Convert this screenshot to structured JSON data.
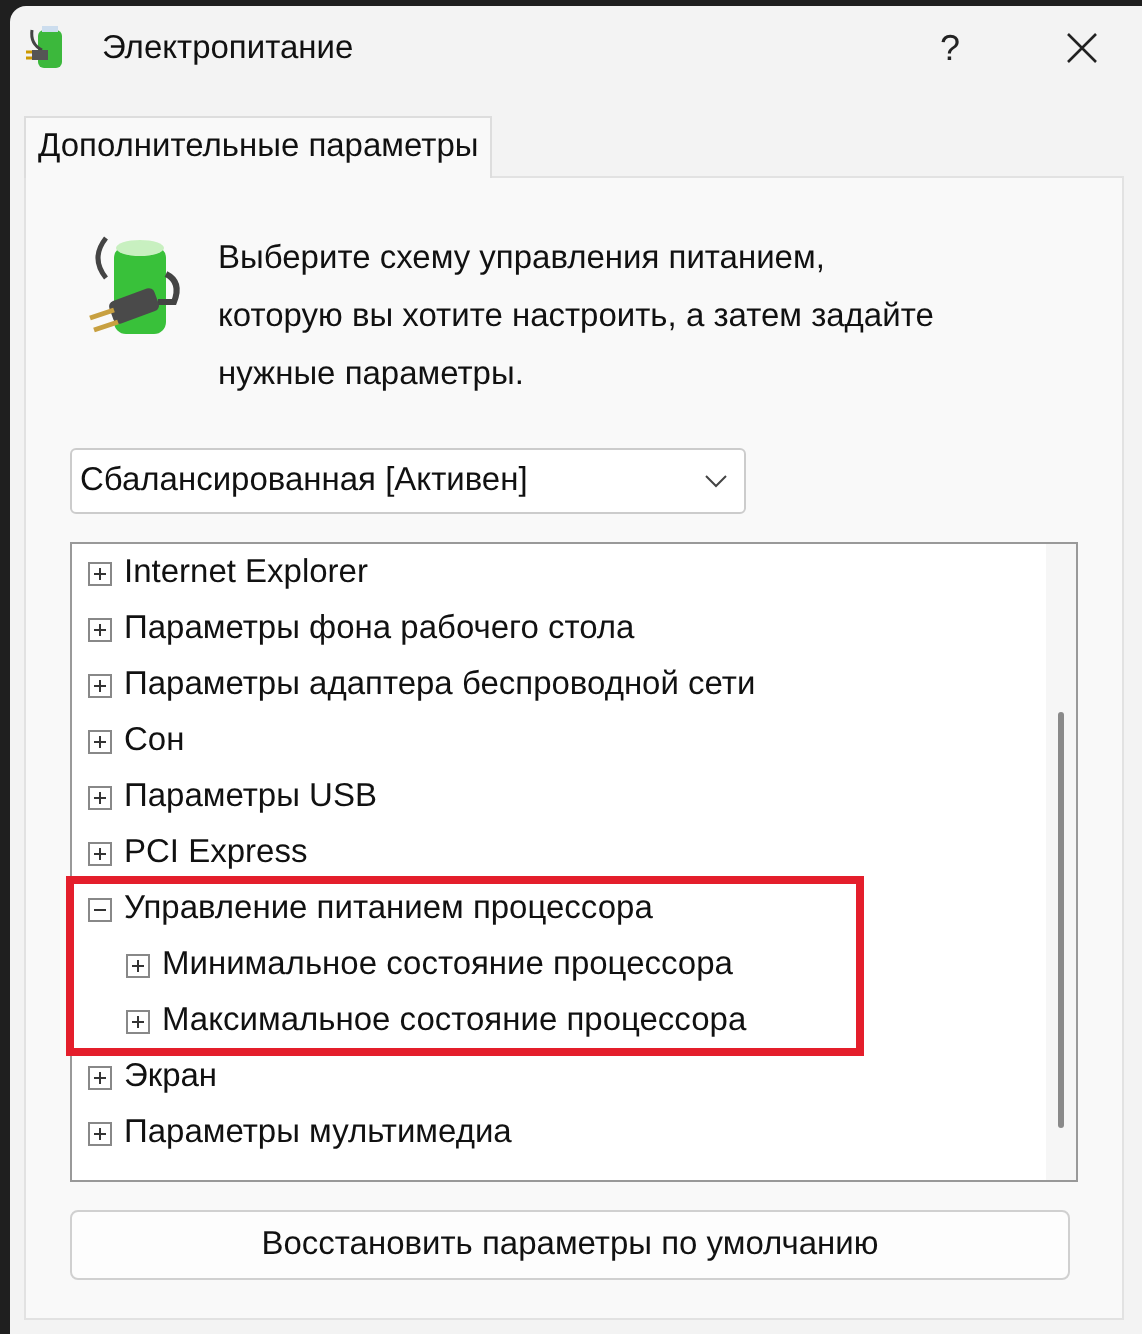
{
  "window": {
    "title": "Электропитание",
    "help": "?"
  },
  "tabs": [
    {
      "label": "Дополнительные параметры",
      "selected": true
    }
  ],
  "description": "Выберите схему управления питанием, которую вы хотите настроить, а затем задайте нужные параметры.",
  "plan_select": {
    "value": "Сбалансированная [Активен]"
  },
  "tree": [
    {
      "label": "Internet Explorer",
      "expanded": false
    },
    {
      "label": "Параметры фона рабочего стола",
      "expanded": false
    },
    {
      "label": "Параметры адаптера беспроводной сети",
      "expanded": false
    },
    {
      "label": "Сон",
      "expanded": false
    },
    {
      "label": "Параметры USB",
      "expanded": false
    },
    {
      "label": "PCI Express",
      "expanded": false
    },
    {
      "label": "Управление питанием процессора",
      "expanded": true,
      "highlighted": true,
      "children": [
        {
          "label": "Минимальное состояние процессора",
          "expanded": false
        },
        {
          "label": "Максимальное состояние процессора",
          "expanded": false
        }
      ]
    },
    {
      "label": "Экран",
      "expanded": false
    },
    {
      "label": "Параметры мультимедиа",
      "expanded": false
    }
  ],
  "buttons": [
    {
      "label": "Восстановить параметры по умолчанию"
    }
  ]
}
